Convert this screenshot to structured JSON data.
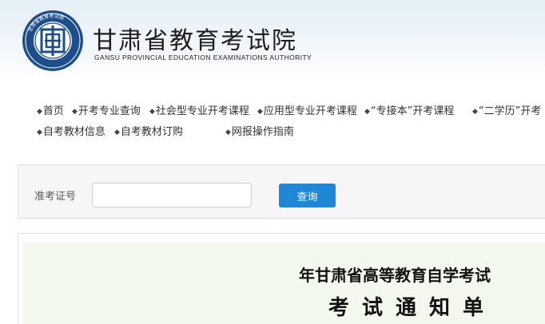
{
  "header": {
    "title": "甘肃省教育考试院",
    "subtitle": "GANSU PROVINCIAL EDUCATION EXAMINATIONS AUTHORITY",
    "logo_text": "甘肃省教育考试院",
    "logo_icon": "exam-authority-emblem-icon",
    "brand_color": "#1c4e8c"
  },
  "nav": {
    "row1": [
      {
        "label": "首页"
      },
      {
        "label": "开考专业查询"
      },
      {
        "label": "社会型专业开考课程"
      },
      {
        "label": "应用型专业开考课程"
      },
      {
        "label": "“专接本”开考课程"
      },
      {
        "label": "“二学历”开考"
      }
    ],
    "row2": [
      {
        "label": "自考教材信息"
      },
      {
        "label": "自考教材订购"
      },
      {
        "label": "网报操作指南"
      }
    ]
  },
  "search": {
    "label": "准考证号",
    "value": "",
    "placeholder": "",
    "button_label": "查询",
    "button_color": "#1e88d6"
  },
  "notice": {
    "title": "年甘肃省高等教育自学考试",
    "subtitle": "考试通知单",
    "background_color": "#f3f8ee"
  }
}
